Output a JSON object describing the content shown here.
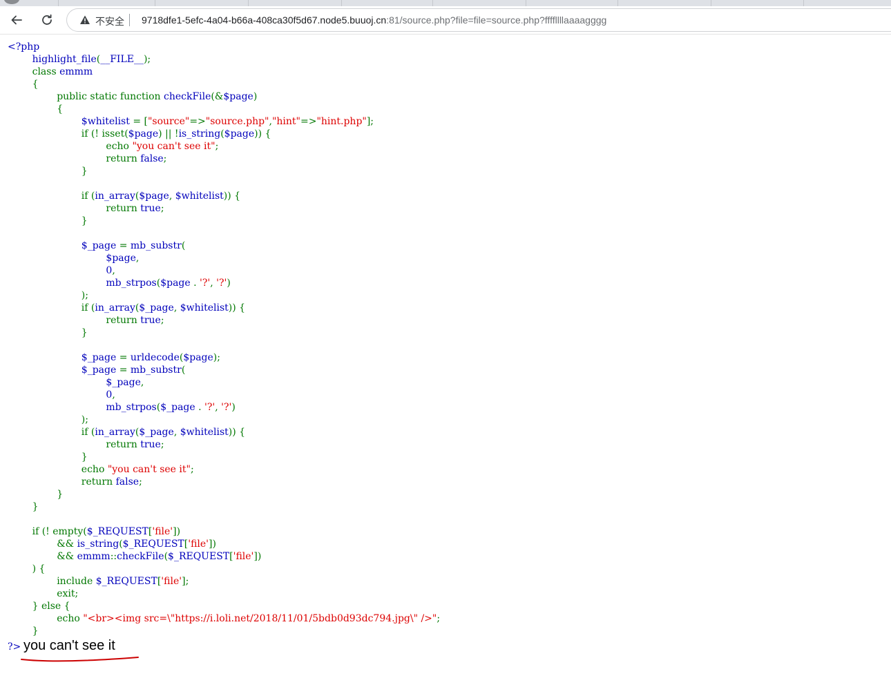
{
  "browser": {
    "security_label": "不安全",
    "url_host": "9718dfe1-5efc-4a04-b66a-408ca30f5d67.node5.buuoj.cn",
    "url_rest": ":81/source.php?file=file=source.php?ffffllllaaaagggg"
  },
  "source_lines": [
    [
      [
        "default",
        "<?php"
      ]
    ],
    [
      [
        "default",
        "        highlight_file"
      ],
      [
        "keyword",
        "("
      ],
      [
        "default",
        "__FILE__"
      ],
      [
        "keyword",
        ");"
      ]
    ],
    [
      [
        "keyword",
        "        class "
      ],
      [
        "default",
        "emmm"
      ]
    ],
    [
      [
        "keyword",
        "        {"
      ]
    ],
    [
      [
        "keyword",
        "                public static function "
      ],
      [
        "default",
        "checkFile"
      ],
      [
        "keyword",
        "(&"
      ],
      [
        "default",
        "$page"
      ],
      [
        "keyword",
        ")"
      ]
    ],
    [
      [
        "keyword",
        "                {"
      ]
    ],
    [
      [
        "default",
        "                        $whitelist "
      ],
      [
        "keyword",
        "= ["
      ],
      [
        "string",
        "\"source\""
      ],
      [
        "keyword",
        "=>"
      ],
      [
        "string",
        "\"source.php\""
      ],
      [
        "keyword",
        ","
      ],
      [
        "string",
        "\"hint\""
      ],
      [
        "keyword",
        "=>"
      ],
      [
        "string",
        "\"hint.php\""
      ],
      [
        "keyword",
        "];"
      ]
    ],
    [
      [
        "keyword",
        "                        if (! isset("
      ],
      [
        "default",
        "$page"
      ],
      [
        "keyword",
        ") || !"
      ],
      [
        "default",
        "is_string"
      ],
      [
        "keyword",
        "("
      ],
      [
        "default",
        "$page"
      ],
      [
        "keyword",
        ")) {"
      ]
    ],
    [
      [
        "keyword",
        "                                echo "
      ],
      [
        "string",
        "\"you can't see it\""
      ],
      [
        "keyword",
        ";"
      ]
    ],
    [
      [
        "keyword",
        "                                return "
      ],
      [
        "default",
        "false"
      ],
      [
        "keyword",
        ";"
      ]
    ],
    [
      [
        "keyword",
        "                        }"
      ]
    ],
    [
      [
        "keyword",
        ""
      ]
    ],
    [
      [
        "keyword",
        "                        if ("
      ],
      [
        "default",
        "in_array"
      ],
      [
        "keyword",
        "("
      ],
      [
        "default",
        "$page"
      ],
      [
        "keyword",
        ", "
      ],
      [
        "default",
        "$whitelist"
      ],
      [
        "keyword",
        ")) {"
      ]
    ],
    [
      [
        "keyword",
        "                                return "
      ],
      [
        "default",
        "true"
      ],
      [
        "keyword",
        ";"
      ]
    ],
    [
      [
        "keyword",
        "                        }"
      ]
    ],
    [
      [
        "keyword",
        ""
      ]
    ],
    [
      [
        "default",
        "                        $_page "
      ],
      [
        "keyword",
        "= "
      ],
      [
        "default",
        "mb_substr"
      ],
      [
        "keyword",
        "("
      ]
    ],
    [
      [
        "default",
        "                                $page"
      ],
      [
        "keyword",
        ","
      ]
    ],
    [
      [
        "default",
        "                                0"
      ],
      [
        "keyword",
        ","
      ]
    ],
    [
      [
        "default",
        "                                mb_strpos"
      ],
      [
        "keyword",
        "("
      ],
      [
        "default",
        "$page "
      ],
      [
        "keyword",
        ". "
      ],
      [
        "string",
        "'?'"
      ],
      [
        "keyword",
        ", "
      ],
      [
        "string",
        "'?'"
      ],
      [
        "keyword",
        ")"
      ]
    ],
    [
      [
        "keyword",
        "                        );"
      ]
    ],
    [
      [
        "keyword",
        "                        if ("
      ],
      [
        "default",
        "in_array"
      ],
      [
        "keyword",
        "("
      ],
      [
        "default",
        "$_page"
      ],
      [
        "keyword",
        ", "
      ],
      [
        "default",
        "$whitelist"
      ],
      [
        "keyword",
        ")) {"
      ]
    ],
    [
      [
        "keyword",
        "                                return "
      ],
      [
        "default",
        "true"
      ],
      [
        "keyword",
        ";"
      ]
    ],
    [
      [
        "keyword",
        "                        }"
      ]
    ],
    [
      [
        "keyword",
        ""
      ]
    ],
    [
      [
        "default",
        "                        $_page "
      ],
      [
        "keyword",
        "= "
      ],
      [
        "default",
        "urldecode"
      ],
      [
        "keyword",
        "("
      ],
      [
        "default",
        "$page"
      ],
      [
        "keyword",
        ");"
      ]
    ],
    [
      [
        "default",
        "                        $_page "
      ],
      [
        "keyword",
        "= "
      ],
      [
        "default",
        "mb_substr"
      ],
      [
        "keyword",
        "("
      ]
    ],
    [
      [
        "default",
        "                                $_page"
      ],
      [
        "keyword",
        ","
      ]
    ],
    [
      [
        "default",
        "                                0"
      ],
      [
        "keyword",
        ","
      ]
    ],
    [
      [
        "default",
        "                                mb_strpos"
      ],
      [
        "keyword",
        "("
      ],
      [
        "default",
        "$_page "
      ],
      [
        "keyword",
        ". "
      ],
      [
        "string",
        "'?'"
      ],
      [
        "keyword",
        ", "
      ],
      [
        "string",
        "'?'"
      ],
      [
        "keyword",
        ")"
      ]
    ],
    [
      [
        "keyword",
        "                        );"
      ]
    ],
    [
      [
        "keyword",
        "                        if ("
      ],
      [
        "default",
        "in_array"
      ],
      [
        "keyword",
        "("
      ],
      [
        "default",
        "$_page"
      ],
      [
        "keyword",
        ", "
      ],
      [
        "default",
        "$whitelist"
      ],
      [
        "keyword",
        ")) {"
      ]
    ],
    [
      [
        "keyword",
        "                                return "
      ],
      [
        "default",
        "true"
      ],
      [
        "keyword",
        ";"
      ]
    ],
    [
      [
        "keyword",
        "                        }"
      ]
    ],
    [
      [
        "keyword",
        "                        echo "
      ],
      [
        "string",
        "\"you can't see it\""
      ],
      [
        "keyword",
        ";"
      ]
    ],
    [
      [
        "keyword",
        "                        return "
      ],
      [
        "default",
        "false"
      ],
      [
        "keyword",
        ";"
      ]
    ],
    [
      [
        "keyword",
        "                }"
      ]
    ],
    [
      [
        "keyword",
        "        }"
      ]
    ],
    [
      [
        "keyword",
        ""
      ]
    ],
    [
      [
        "keyword",
        "        if (! empty("
      ],
      [
        "default",
        "$_REQUEST"
      ],
      [
        "keyword",
        "["
      ],
      [
        "string",
        "'file'"
      ],
      [
        "keyword",
        "])"
      ]
    ],
    [
      [
        "keyword",
        "                && "
      ],
      [
        "default",
        "is_string"
      ],
      [
        "keyword",
        "("
      ],
      [
        "default",
        "$_REQUEST"
      ],
      [
        "keyword",
        "["
      ],
      [
        "string",
        "'file'"
      ],
      [
        "keyword",
        "])"
      ]
    ],
    [
      [
        "keyword",
        "                && "
      ],
      [
        "default",
        "emmm"
      ],
      [
        "keyword",
        "::"
      ],
      [
        "default",
        "checkFile"
      ],
      [
        "keyword",
        "("
      ],
      [
        "default",
        "$_REQUEST"
      ],
      [
        "keyword",
        "["
      ],
      [
        "string",
        "'file'"
      ],
      [
        "keyword",
        "])"
      ]
    ],
    [
      [
        "keyword",
        "        ) {"
      ]
    ],
    [
      [
        "keyword",
        "                include "
      ],
      [
        "default",
        "$_REQUEST"
      ],
      [
        "keyword",
        "["
      ],
      [
        "string",
        "'file'"
      ],
      [
        "keyword",
        "];"
      ]
    ],
    [
      [
        "keyword",
        "                exit;"
      ]
    ],
    [
      [
        "keyword",
        "        } else {"
      ]
    ],
    [
      [
        "keyword",
        "                echo "
      ],
      [
        "string",
        "\"<br><img src=\\\"https://i.loli.net/2018/11/01/5bdb0d93dc794.jpg\\\" />\""
      ],
      [
        "keyword",
        ";"
      ]
    ],
    [
      [
        "keyword",
        "        }"
      ]
    ]
  ],
  "php_close": "?>",
  "page_output": "you can't see it",
  "colors": {
    "default": "#0000bb",
    "keyword": "#007700",
    "string": "#dd0000",
    "underline": "#cc0000"
  }
}
